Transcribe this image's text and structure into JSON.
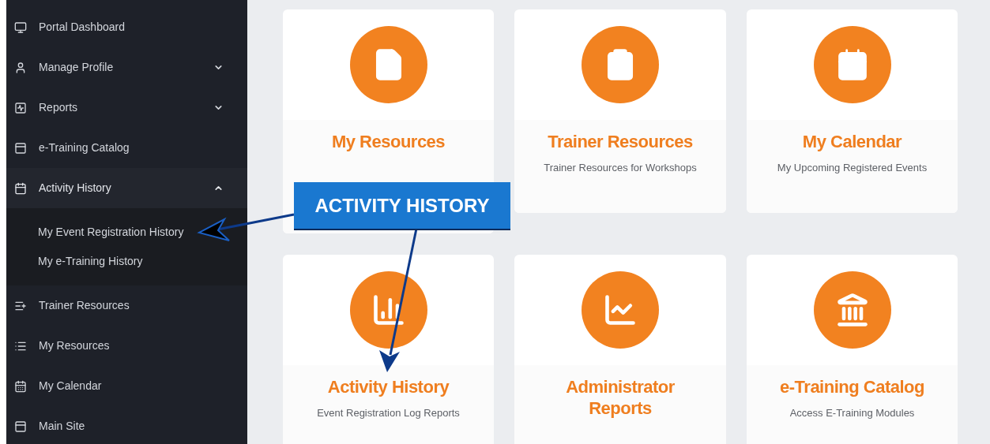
{
  "sidebar": {
    "items": [
      {
        "label": "Portal Dashboard",
        "selected": false
      },
      {
        "label": "Manage Profile",
        "selected": false,
        "expanded": false
      },
      {
        "label": "Reports",
        "selected": false,
        "expanded": false
      },
      {
        "label": "e-Training Catalog",
        "selected": false
      },
      {
        "label": "Activity History",
        "selected": true,
        "expanded": true,
        "children": [
          {
            "label": "My Event Registration History"
          },
          {
            "label": "My e-Training History"
          }
        ]
      },
      {
        "label": "Trainer Resources",
        "selected": false
      },
      {
        "label": "My Resources",
        "selected": false
      },
      {
        "label": "My Calendar",
        "selected": false
      },
      {
        "label": "Main Site",
        "selected": false
      }
    ]
  },
  "cards": [
    {
      "title": "My Resources"
    },
    {
      "title": "Trainer Resources",
      "description": "Trainer Resources for Workshops"
    },
    {
      "title": "My Calendar",
      "description": "My Upcoming Registered Events"
    },
    {
      "title": "Activity History",
      "description": "Event Registration Log Reports"
    },
    {
      "title": "Administrator Reports"
    },
    {
      "title": "e-Training Catalog",
      "description": "Access E-Training Modules"
    }
  ],
  "callout": {
    "label": "ACTIVITY HISTORY"
  }
}
